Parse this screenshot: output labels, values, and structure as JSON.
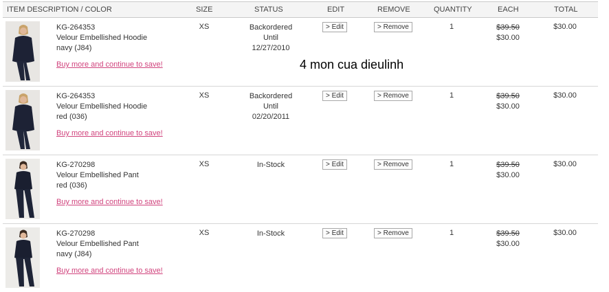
{
  "columns": {
    "item": "ITEM DESCRIPTION / COLOR",
    "size": "SIZE",
    "status": "STATUS",
    "edit": "EDIT",
    "remove": "REMOVE",
    "quantity": "QUANTITY",
    "each": "EACH",
    "total": "TOTAL"
  },
  "overlay_text": "4 mon cua dieulinh",
  "items": [
    {
      "sku": "KG-264353",
      "name": "Velour Embellished Hoodie",
      "color": "navy (J84)",
      "buy_more": "Buy more and continue to save!",
      "size": "XS",
      "status_lines": [
        "Backordered",
        "Until",
        "12/27/2010"
      ],
      "edit_label": "> Edit",
      "remove_label": "> Remove",
      "quantity": "1",
      "price_old": "$39.50",
      "price_new": "$30.00",
      "total": "$30.00"
    },
    {
      "sku": "KG-264353",
      "name": "Velour Embellished Hoodie",
      "color": "red (036)",
      "buy_more": "Buy more and continue to save!",
      "size": "XS",
      "status_lines": [
        "Backordered",
        "Until",
        "02/20/2011"
      ],
      "edit_label": "> Edit",
      "remove_label": "> Remove",
      "quantity": "1",
      "price_old": "$39.50",
      "price_new": "$30.00",
      "total": "$30.00"
    },
    {
      "sku": "KG-270298",
      "name": "Velour Embellished Pant",
      "color": "red (036)",
      "buy_more": "Buy more and continue to save!",
      "size": "XS",
      "status_lines": [
        "In-Stock",
        "",
        ""
      ],
      "edit_label": "> Edit",
      "remove_label": "> Remove",
      "quantity": "1",
      "price_old": "$39.50",
      "price_new": "$30.00",
      "total": "$30.00"
    },
    {
      "sku": "KG-270298",
      "name": "Velour Embellished Pant",
      "color": "navy (J84)",
      "buy_more": "Buy more and continue to save!",
      "size": "XS",
      "status_lines": [
        "In-Stock",
        "",
        ""
      ],
      "edit_label": "> Edit",
      "remove_label": "> Remove",
      "quantity": "1",
      "price_old": "$39.50",
      "price_new": "$30.00",
      "total": "$30.00"
    }
  ],
  "colors": {
    "link": "#d0427c",
    "border": "#c9c9c9",
    "header_bg": "#f4f4f4"
  }
}
